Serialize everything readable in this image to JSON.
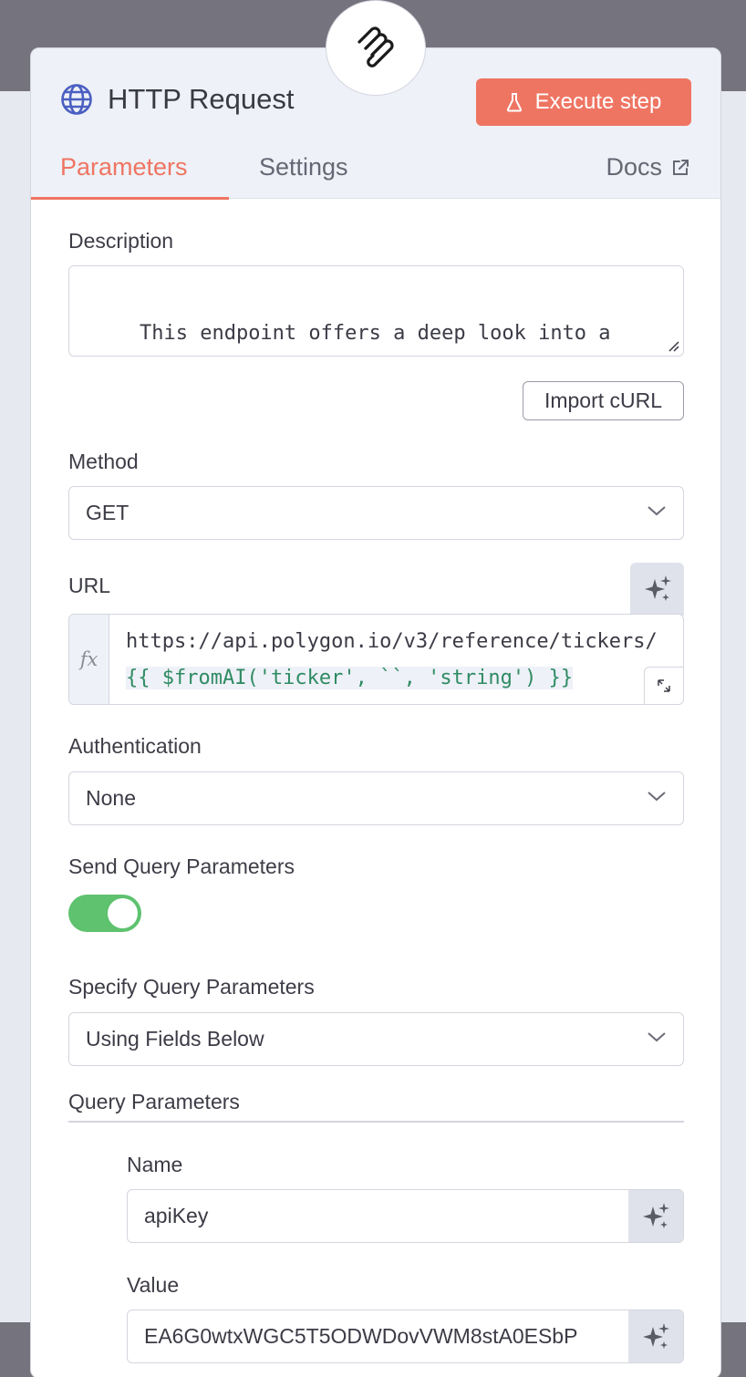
{
  "node": {
    "title": "HTTP Request",
    "execute_label": "Execute step"
  },
  "tabs": {
    "parameters": "Parameters",
    "settings": "Settings",
    "docs": "Docs"
  },
  "description": {
    "label": "Description",
    "value": "This endpoint offers a deep look into a company’s fundamental attributes, including its primary exchange, standardized identifiers"
  },
  "import_curl_label": "Import cURL",
  "method": {
    "label": "Method",
    "value": "GET"
  },
  "url": {
    "label": "URL",
    "fx": "fx",
    "prefix": "https://api.polygon.io/v3/reference/tickers/",
    "expression": "{{ $fromAI('ticker', ``, 'string') }}"
  },
  "authentication": {
    "label": "Authentication",
    "value": "None"
  },
  "send_query": {
    "label": "Send Query Parameters",
    "enabled": true
  },
  "specify_query": {
    "label": "Specify Query Parameters",
    "value": "Using Fields Below"
  },
  "query_params": {
    "title": "Query Parameters",
    "name_label": "Name",
    "name_value": "apiKey",
    "value_label": "Value",
    "value_value": "EA6G0wtxWGC5T5ODWDovVWM8stA0ESbP"
  },
  "colors": {
    "accent": "#ef7563",
    "toggle_on": "#5ec26f",
    "globe": "#4a5fc1"
  },
  "icons": [
    "node-logo-icon",
    "globe-icon",
    "flask-icon",
    "external-link-icon",
    "resize-grip-icon",
    "chevron-down-icon",
    "sparkle-icon",
    "expand-icon"
  ]
}
